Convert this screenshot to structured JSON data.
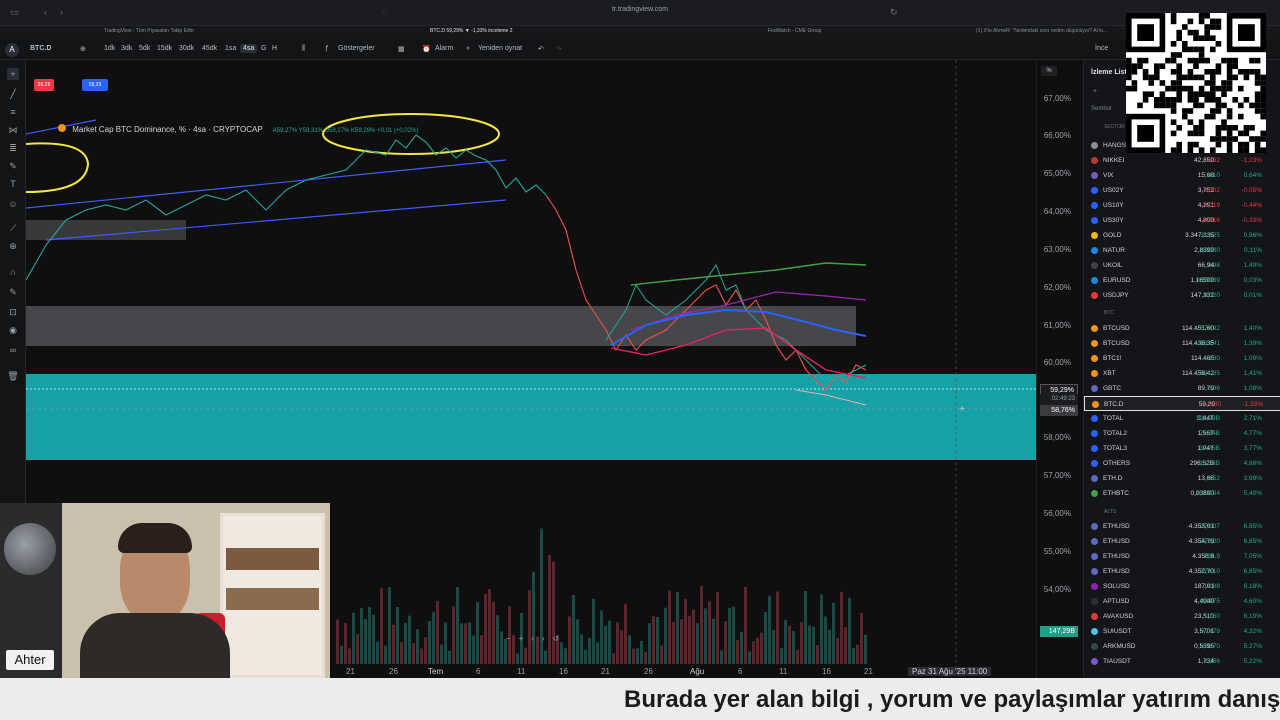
{
  "browser": {
    "url": "tr.tradingview.com"
  },
  "tabs": [
    "TradingView - Tüm Piyasaları Takip Edin",
    "BTC.D 59,29% ▼ -1,33% inceleme 2",
    "FedWatch - CME Group",
    "(1) X'te AhmeR: \"Nedendaki soru neden düşünüyor? Al ki..."
  ],
  "toolbar": {
    "symbol": "BTC.D",
    "intervals": [
      "1dk",
      "3dk",
      "5dk",
      "15dk",
      "30dk",
      "45dk",
      "1sa",
      "4sa",
      "G",
      "H"
    ],
    "active_interval": "4sa",
    "indicators": "Göstergeler",
    "alarm": "Alarm",
    "replay": "Yeniden oynat",
    "right_label": "İnce"
  },
  "legend": {
    "title": "Market Cap BTC Dominance, % · 4sa · CRYPTOCAP",
    "ohlc": "A59,27% Y59,31% D59,27% K59,29% +0,01 (+0,02%)",
    "badge_sell": "59,29",
    "badge_buy": "59,29"
  },
  "chart": {
    "y_ticks": [
      "67,00%",
      "66,00%",
      "65,00%",
      "64,00%",
      "63,00%",
      "62,00%",
      "61,00%",
      "60,00%",
      "58,00%",
      "57,00%",
      "56,00%",
      "55,00%",
      "54,00%"
    ],
    "price_label": "59,29%",
    "countdown": "02:49:23",
    "crosshair_price": "58,76%",
    "volume_label": "147,29B",
    "x_ticks": [
      "21",
      "26",
      "Tem",
      "6",
      "11",
      "16",
      "21",
      "26",
      "Ağu",
      "6",
      "11",
      "16",
      "21"
    ],
    "crosshair_date": "Paz 31 Ağu '25  11:00",
    "percent_toggle": "%"
  },
  "watchlist": {
    "title": "İzleme Listesi",
    "header": "Sembol",
    "sections": [
      "SECTOR",
      "BTC",
      "ALTS"
    ],
    "rows": [
      {
        "sym": "HANGSENG",
        "last": "",
        "chg": "",
        "pct": "",
        "dir": "neg",
        "color": "#8e8e8e"
      },
      {
        "sym": "NIKKEI",
        "last": "42,850",
        "chg": "-332",
        "pct": "-1,23%",
        "dir": "neg",
        "color": "#c0392b"
      },
      {
        "sym": "VIX",
        "last": "15,68",
        "chg": "0,10",
        "pct": "0,64%",
        "dir": "pos",
        "color": "#7e57c2"
      },
      {
        "sym": "US02Y",
        "last": "3,752",
        "chg": "-0,002",
        "pct": "-0,05%",
        "dir": "neg",
        "color": "#2962ff"
      },
      {
        "sym": "US10Y",
        "last": "4,291",
        "chg": "-0,019",
        "pct": "-0,44%",
        "dir": "neg",
        "color": "#2962ff"
      },
      {
        "sym": "US30Y",
        "last": "4,890",
        "chg": "-0,016",
        "pct": "-0,33%",
        "dir": "neg",
        "color": "#2962ff"
      },
      {
        "sym": "GOLD",
        "last": "3.347,335",
        "chg": "31,625",
        "pct": "0,96%",
        "dir": "pos",
        "color": "#f0b90b"
      },
      {
        "sym": "NATUR",
        "last": "2,8390",
        "chg": "0,0030",
        "pct": "0,11%",
        "dir": "pos",
        "color": "#1e88e5"
      },
      {
        "sym": "UKOIL",
        "last": "66,94",
        "chg": "0,98",
        "pct": "1,49%",
        "dir": "pos",
        "color": "#424242"
      },
      {
        "sym": "EURUSD",
        "last": "1,16500",
        "chg": "0,00039",
        "pct": "0,03%",
        "dir": "pos",
        "color": "#1e88e5"
      },
      {
        "sym": "USDJPY",
        "last": "147,332",
        "chg": "0,020",
        "pct": "0,01%",
        "dir": "pos",
        "color": "#e53935"
      },
      {
        "sym": "BTCUSD",
        "last": "114.451,60",
        "chg": "1.579,92",
        "pct": "1,40%",
        "dir": "pos",
        "color": "#f7931a"
      },
      {
        "sym": "BTCUSD",
        "last": "114.436,35",
        "chg": "1.563,41",
        "pct": "1,39%",
        "dir": "pos",
        "color": "#f7931a"
      },
      {
        "sym": "BTC1!",
        "last": "114.465",
        "chg": "1.230",
        "pct": "1,09%",
        "dir": "pos",
        "color": "#f7931a"
      },
      {
        "sym": "XBT",
        "last": "114.456,42",
        "chg": "1.591,35",
        "pct": "1,41%",
        "dir": "pos",
        "color": "#f7931a"
      },
      {
        "sym": "GBTC",
        "last": "89,79",
        "chg": "0,96",
        "pct": "1,08%",
        "dir": "pos",
        "color": "#5c6bc0"
      },
      {
        "sym": "BTC.D",
        "last": "59,29",
        "chg": "-0,80",
        "pct": "-1,33%",
        "dir": "neg",
        "color": "#f7931a"
      },
      {
        "sym": "TOTAL",
        "last": "3,84T",
        "chg": "101,29B",
        "pct": "2,71%",
        "dir": "pos",
        "color": "#2962ff"
      },
      {
        "sym": "TOTAL2",
        "last": "1,56T",
        "chg": "71,24B",
        "pct": "4,77%",
        "dir": "pos",
        "color": "#2962ff"
      },
      {
        "sym": "TOTAL3",
        "last": "1,04T",
        "chg": "37,75B",
        "pct": "3,77%",
        "dir": "pos",
        "color": "#2962ff"
      },
      {
        "sym": "OTHERS",
        "last": "296,52B",
        "chg": "13,78B",
        "pct": "4,88%",
        "dir": "pos",
        "color": "#2962ff"
      },
      {
        "sym": "ETH.D",
        "last": "13,68",
        "chg": "0,52",
        "pct": "3,99%",
        "dir": "pos",
        "color": "#5c6bc0"
      },
      {
        "sym": "ETHBTC",
        "last": "0,03800",
        "chg": "0,00194",
        "pct": "5,40%",
        "dir": "pos",
        "color": "#43a047"
      },
      {
        "sym": "ETHUSD",
        "last": "4.353,01",
        "chg": "279,07",
        "pct": "6,85%",
        "dir": "pos",
        "color": "#5c6bc0"
      },
      {
        "sym": "ETHUSD",
        "last": "4.354,79",
        "chg": "279,20",
        "pct": "6,85%",
        "dir": "pos",
        "color": "#5c6bc0"
      },
      {
        "sym": "ETHUSD",
        "last": "4.356,9",
        "chg": "286,9",
        "pct": "7,05%",
        "dir": "pos",
        "color": "#5c6bc0"
      },
      {
        "sym": "ETHUSD",
        "last": "4.352,70",
        "chg": "279,10",
        "pct": "6,85%",
        "dir": "pos",
        "color": "#5c6bc0"
      },
      {
        "sym": "SOLUSD",
        "last": "187,01",
        "chg": "10,88",
        "pct": "6,18%",
        "dir": "pos",
        "color": "#8e24aa"
      },
      {
        "sym": "APTUSD",
        "last": "4,4940",
        "chg": "0,1975",
        "pct": "4,60%",
        "dir": "pos",
        "color": "#263238"
      },
      {
        "sym": "AVAXUSD",
        "last": "23,510",
        "chg": "1,160",
        "pct": "6,19%",
        "dir": "pos",
        "color": "#e53935"
      },
      {
        "sym": "SUIUSDT",
        "last": "3,5701",
        "chg": "0,1479",
        "pct": "4,32%",
        "dir": "pos",
        "color": "#4fc3f7"
      },
      {
        "sym": "ARKMUSD",
        "last": "0,5395",
        "chg": "0,0270",
        "pct": "5,27%",
        "dir": "pos",
        "color": "#37474f"
      },
      {
        "sym": "TIAUSDT",
        "last": "1,734",
        "chg": "0,086",
        "pct": "5,22%",
        "dir": "pos",
        "color": "#7e57c2"
      }
    ]
  },
  "webcam": {
    "name": "Ahter"
  },
  "ticker": {
    "text": "Burada yer alan bilgi , yorum ve paylaşımlar yatırım danışmanlığı kapsamında değildir."
  },
  "colors": {
    "accent": "#2962ff",
    "up": "#22ab94",
    "down": "#f23645",
    "zone": "#14a2a6",
    "annot": "#f5e642"
  }
}
